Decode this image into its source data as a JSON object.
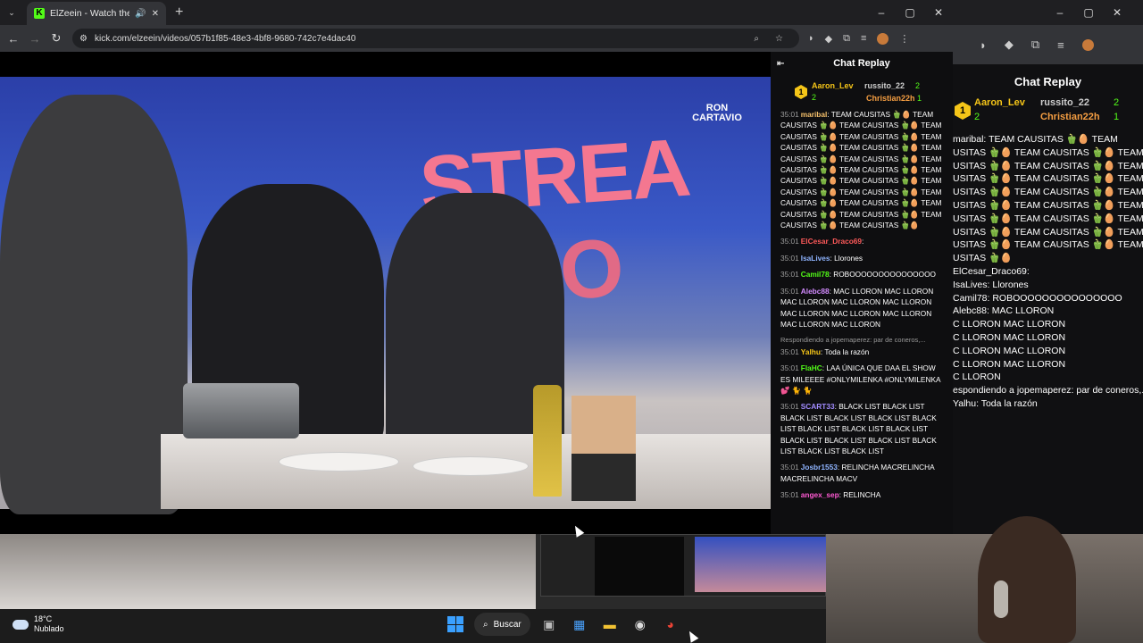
{
  "browser": {
    "tab_title": "ElZeein - Watch the VOD o",
    "tab_favicon": "K",
    "new_tab": "+",
    "url": "kick.com/elzeein/videos/057b1f85-48e3-4bf8-9680-742c7e4dac40",
    "window_controls": [
      "–",
      "▢",
      "✕"
    ]
  },
  "chat": {
    "title": "Chat Replay",
    "leaders": [
      {
        "rank": "1",
        "name": "Aaron_Lev",
        "count": "2"
      },
      {
        "name": "russito_22",
        "count": "2"
      },
      {
        "name": "Christian22h",
        "count": "1"
      }
    ],
    "messages": [
      {
        "ts": "35:01",
        "user": "maribal",
        "color": "#f5c06b",
        "text": "TEAM CAUSITAS 🫑🥚 TEAM CAUSITAS 🫑🥚 TEAM CAUSITAS 🫑🥚 TEAM CAUSITAS 🫑🥚 TEAM CAUSITAS 🫑🥚 TEAM CAUSITAS 🫑🥚 TEAM CAUSITAS 🫑🥚 TEAM CAUSITAS 🫑🥚 TEAM CAUSITAS 🫑🥚 TEAM CAUSITAS 🫑🥚 TEAM CAUSITAS 🫑🥚 TEAM CAUSITAS 🫑🥚 TEAM CAUSITAS 🫑🥚 TEAM CAUSITAS 🫑🥚 TEAM CAUSITAS 🫑🥚 TEAM CAUSITAS 🫑🥚 TEAM CAUSITAS 🫑🥚 TEAM CAUSITAS 🫑🥚 TEAM CAUSITAS 🫑🥚 TEAM CAUSITAS 🫑🥚 TEAM CAUSITAS 🫑🥚"
      },
      {
        "ts": "35:01",
        "user": "ElCesar_Draco69",
        "color": "#ff5a5a",
        "text": ""
      },
      {
        "ts": "35:01",
        "user": "IsaLives",
        "color": "#8fb4ff",
        "text": "Llorones"
      },
      {
        "ts": "35:01",
        "user": "Camil78",
        "color": "#53fc18",
        "text": "ROBOOOOOOOOOOOOOOO"
      },
      {
        "ts": "35:01",
        "user": "Alebc88",
        "color": "#d38bff",
        "text": "MAC LLORON MAC LLORON MAC LLORON MAC LLORON MAC LLORON MAC LLORON MAC LLORON MAC LLORON MAC LLORON MAC LLORON"
      },
      {
        "reply": "Respondiendo a jopemaperez: par de coneros,...",
        "ts": "35:01",
        "user": "Yalhu",
        "color": "#f5c518",
        "text": "Toda la razón"
      },
      {
        "ts": "35:01",
        "user": "FlaHC",
        "color": "#53fc18",
        "text": "LAA ÚNICA QUE DAA EL SHOW ES MILEEEE #ONLYMILENKA #ONLYMILENKA 💕 🐈 🐈"
      },
      {
        "ts": "35:01",
        "user": "SCART33",
        "color": "#a28cff",
        "text": "BLACK LIST BLACK LIST BLACK LIST BLACK LIST BLACK LIST BLACK LIST BLACK LIST BLACK LIST BLACK LIST BLACK LIST BLACK LIST BLACK LIST BLACK LIST BLACK LIST BLACK LIST"
      },
      {
        "ts": "35:01",
        "user": "Josbr1553",
        "color": "#8fb4ff",
        "text": "RELINCHA MACRELINCHA MACRELINCHA MACV"
      },
      {
        "ts": "35:01",
        "user": "angex_sep",
        "color": "#ff5ad3",
        "text": "RELINCHA"
      }
    ]
  },
  "right_window": {
    "title": "Chat Replay",
    "leaders": [
      {
        "rank": "1",
        "name": "Aaron_Lev",
        "count": "2"
      },
      {
        "name": "russito_22",
        "count": "2"
      },
      {
        "name": "Christian22h",
        "count": "1"
      }
    ],
    "lines": [
      "maribal: TEAM CAUSITAS 🫑🥚 TEAM",
      "USITAS 🫑🥚 TEAM CAUSITAS 🫑🥚 TEAM",
      "USITAS 🫑🥚 TEAM CAUSITAS 🫑🥚 TEAM",
      "USITAS 🫑🥚 TEAM CAUSITAS 🫑🥚 TEAM",
      "USITAS 🫑🥚 TEAM CAUSITAS 🫑🥚 TEAM",
      "USITAS 🫑🥚 TEAM CAUSITAS 🫑🥚 TEAM",
      "USITAS 🫑🥚 TEAM CAUSITAS 🫑🥚 TEAM",
      "USITAS 🫑🥚 TEAM CAUSITAS 🫑🥚 TEAM",
      "USITAS 🫑🥚 TEAM CAUSITAS 🫑🥚 TEAM",
      "USITAS 🫑🥚",
      "ElCesar_Draco69:",
      "IsaLives: Llorones",
      "Camil78: ROBOOOOOOOOOOOOOOO",
      "Alebc88: MAC LLORON",
      "C LLORON MAC LLORON",
      "C LLORON MAC LLORON",
      "C LLORON MAC LLORON",
      "C LLORON MAC LLORON",
      "C LLORON",
      "espondiendo a jopemaperez: par de coneros,...",
      "Yalhu: Toda la razón"
    ]
  },
  "video": {
    "banner_text_1": "STREA",
    "banner_text_2": "VAZO",
    "sponsor": "RON CARTAVIO"
  },
  "taskbar": {
    "temperature": "18°C",
    "condition": "Nublado",
    "search_label": "Buscar"
  }
}
